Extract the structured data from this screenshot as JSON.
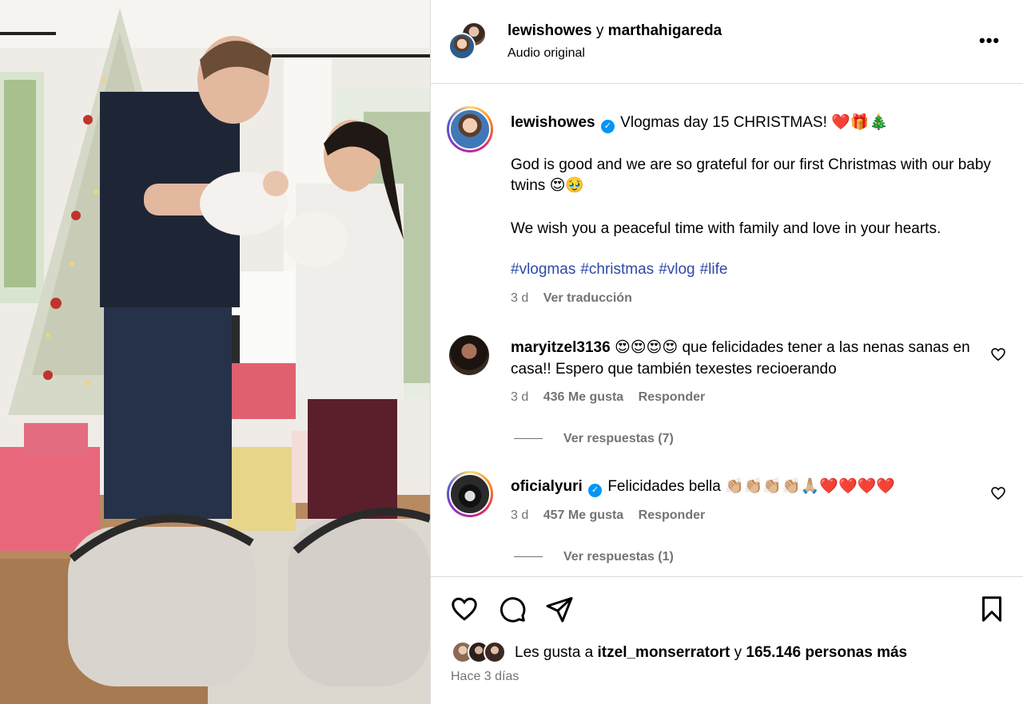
{
  "header": {
    "user1": "lewishowes",
    "joiner": "y",
    "user2": "marthahigareda",
    "audio": "Audio original",
    "more_icon": "ellipsis-icon"
  },
  "caption": {
    "username": "lewishowes",
    "title": "Vlogmas day 15 CHRISTMAS! ❤️🎁🎄",
    "para1": "God is good and we are so grateful for our first Christmas with our baby twins 😍🥹",
    "para2": "We wish you a peaceful time with family and love in your hearts.",
    "hashtags": [
      "#vlogmas",
      "#christmas",
      "#vlog",
      "#life"
    ],
    "time": "3 d",
    "translate": "Ver traducción"
  },
  "comments": [
    {
      "username": "maryitzel3136",
      "text": "😍😍😍😍 que felicidades tener a las nenas sanas en casa!! Espero que también texestes recioerando",
      "time": "3 d",
      "likes": "436 Me gusta",
      "reply": "Responder",
      "view_replies": "Ver respuestas (7)"
    },
    {
      "username": "oficialyuri",
      "text": "Felicidades bella 👏🏼👏🏼👏🏼👏🏼🙏🏼❤️❤️❤️❤️",
      "time": "3 d",
      "likes": "457 Me gusta",
      "reply": "Responder",
      "view_replies": "Ver respuestas (1)"
    }
  ],
  "footer": {
    "likes_prefix": "Les gusta a",
    "likes_user": "itzel_monserratort",
    "likes_joiner": "y",
    "likes_count": "165.146 personas más",
    "ago": "Hace 3 días"
  },
  "colors": {
    "link": "#2c4aa8",
    "muted": "#737373",
    "verified": "#0095f6",
    "border": "#dbdbdb"
  }
}
